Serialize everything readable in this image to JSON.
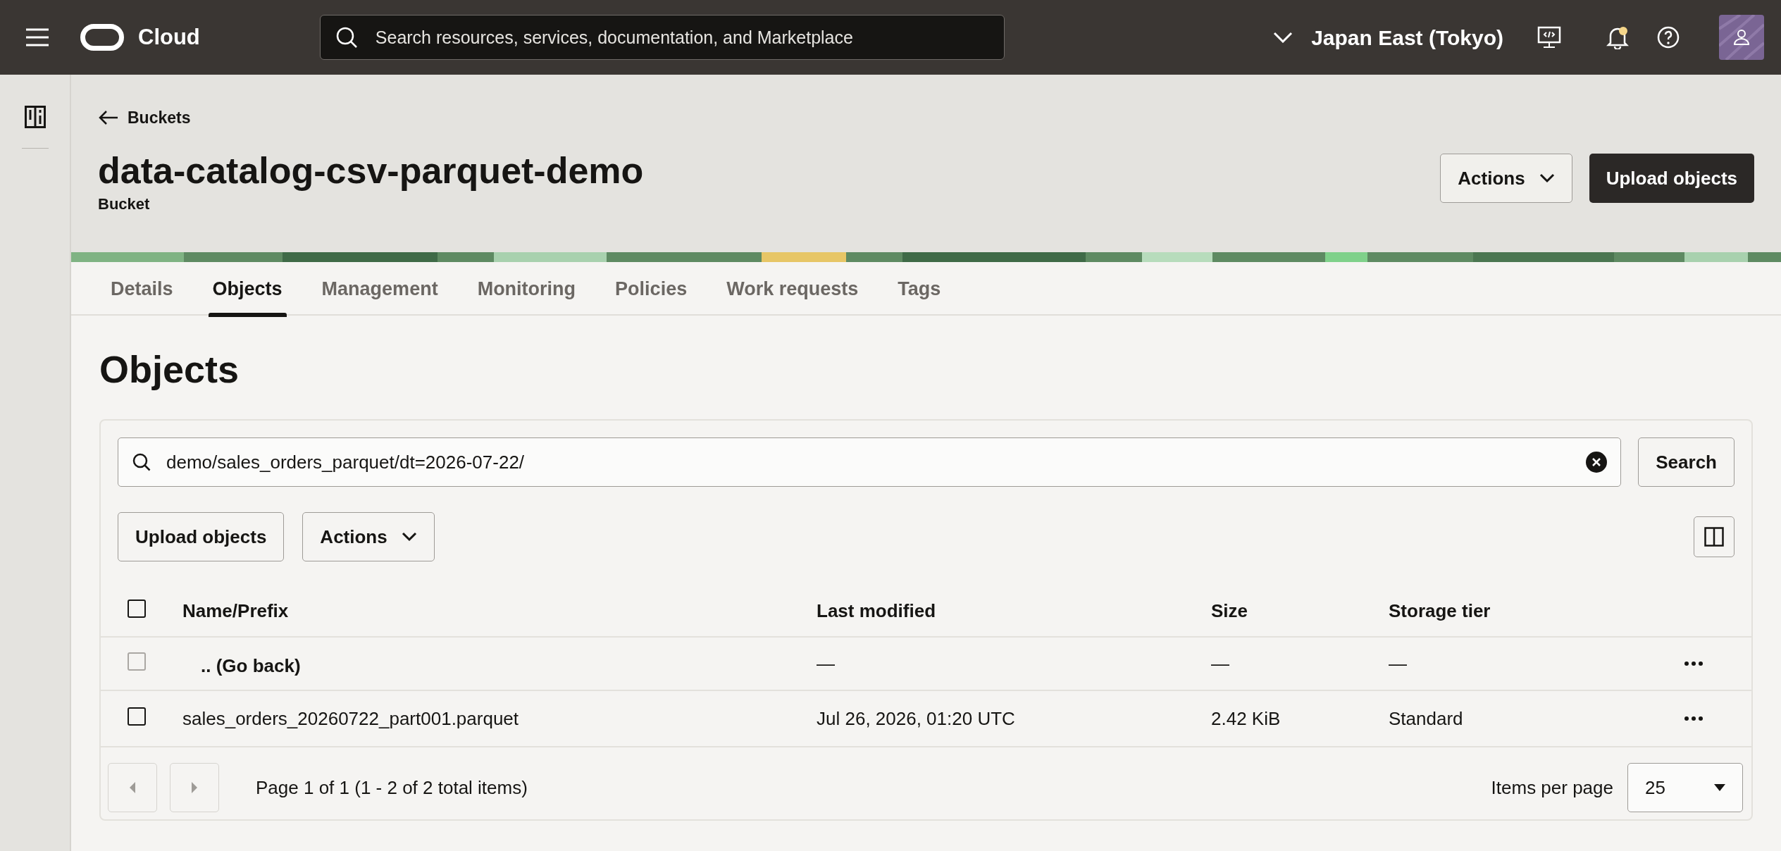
{
  "topbar": {
    "brand": "Cloud",
    "search": {
      "placeholder": "Search resources, services, documentation, and Marketplace"
    },
    "region": "Japan East (Tokyo)"
  },
  "breadcrumb": "Buckets",
  "title": "data-catalog-csv-parquet-demo",
  "subtitle": "Bucket",
  "header_buttons": [
    {
      "label": "Actions",
      "kind": "dropdown"
    },
    {
      "label": "Upload objects",
      "kind": "primary"
    }
  ],
  "tabs": [
    {
      "label": "Details",
      "selected": false
    },
    {
      "label": "Objects",
      "selected": true
    },
    {
      "label": "Management",
      "selected": false
    },
    {
      "label": "Monitoring",
      "selected": false
    },
    {
      "label": "Policies",
      "selected": false
    },
    {
      "label": "Work requests",
      "selected": false
    },
    {
      "label": "Tags",
      "selected": false
    }
  ],
  "section_title": "Objects",
  "filter": {
    "value": "demo/sales_orders_parquet/dt=2026-07-22/",
    "button": "Search"
  },
  "toolbar_buttons": [
    {
      "label": "Upload objects",
      "kind": "plain"
    },
    {
      "label": "Actions",
      "kind": "dropdown"
    }
  ],
  "table": {
    "columns": [
      "Name/Prefix",
      "Last modified",
      "Size",
      "Storage tier"
    ],
    "header_checked": false,
    "rows": [
      {
        "kind": "parent",
        "checked": false,
        "disabled": true,
        "cells": [
          ".. (Go back)",
          "—",
          "—",
          "—"
        ]
      },
      {
        "kind": "object",
        "checked": false,
        "disabled": false,
        "cells": [
          "sales_orders_20260722_part001.parquet",
          "Jul 26, 2026, 01:20 UTC",
          "2.42 KiB",
          "Standard"
        ]
      }
    ]
  },
  "pagination": {
    "summary": "Page 1 of 1 (1 - 2 of 2 total items)",
    "prev_disabled": true,
    "next_disabled": true,
    "per_page_label": "Items per page",
    "per_page": "25"
  }
}
